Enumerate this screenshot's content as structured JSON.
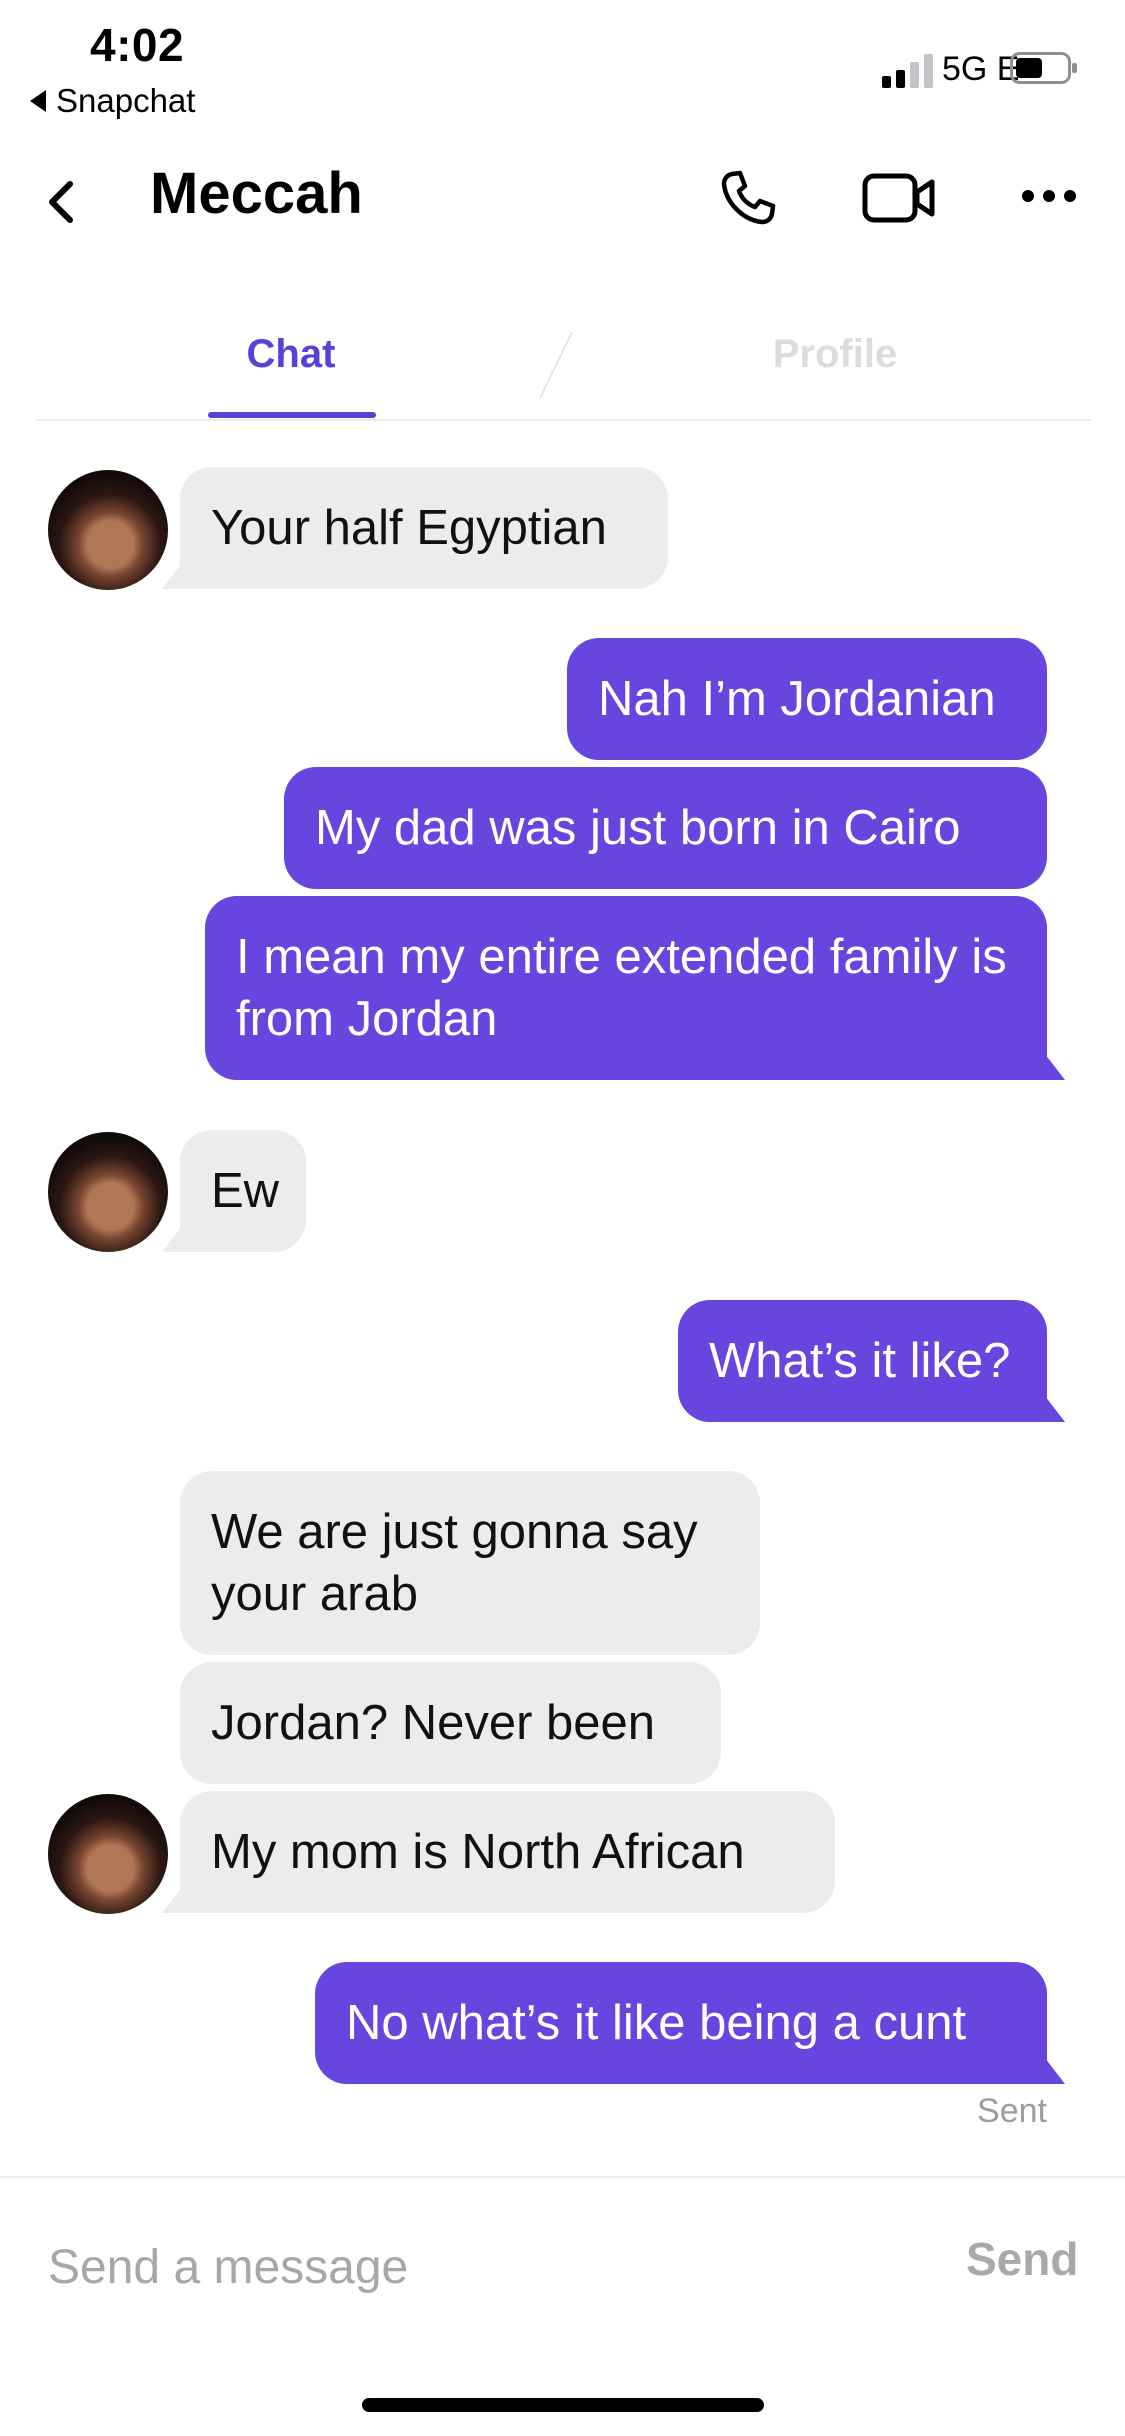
{
  "status_bar": {
    "time": "4:02",
    "back_app": "Snapchat",
    "network": "5G E"
  },
  "header": {
    "title": "Meccah",
    "icons": [
      "back-chevron-icon",
      "phone-icon",
      "video-camera-icon",
      "more-icon"
    ]
  },
  "tabs": [
    {
      "label": "Chat",
      "active": true
    },
    {
      "label": "Profile",
      "active": false
    }
  ],
  "messages": [
    {
      "from": "them",
      "text": "Your half Egyptian"
    },
    {
      "from": "me",
      "text": "Nah I’m Jordanian"
    },
    {
      "from": "me",
      "text": "My dad was just born in Cairo"
    },
    {
      "from": "me",
      "text": "I mean my entire extended family is from Jordan"
    },
    {
      "from": "them",
      "text": "Ew"
    },
    {
      "from": "me",
      "text": "What’s it like?"
    },
    {
      "from": "them",
      "text": "We are just gonna say your arab"
    },
    {
      "from": "them",
      "text": "Jordan? Never been"
    },
    {
      "from": "them",
      "text": "My mom is North African"
    },
    {
      "from": "me",
      "text": "No what’s it like being a cunt"
    }
  ],
  "delivery_status": "Sent",
  "composer": {
    "placeholder": "Send a message",
    "send_label": "Send"
  },
  "colors": {
    "accent": "#5b3fd9",
    "outgoing_bubble": "#6746e0",
    "incoming_bubble": "#ececed"
  }
}
